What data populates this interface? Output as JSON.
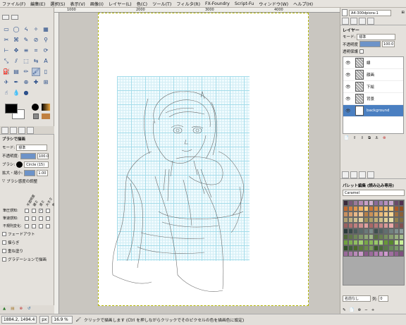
{
  "menu": [
    "ファイル(F)",
    "編集(E)",
    "選択(S)",
    "表示(V)",
    "画像(I)",
    "レイヤー(L)",
    "色(C)",
    "ツール(T)",
    "フィルタ(R)",
    "FX-Foundry",
    "Script-Fu",
    "ウィンドウ(W)",
    "ヘルプ(H)"
  ],
  "ruler_ticks": [
    "1000",
    "2000",
    "3000",
    "4000"
  ],
  "tools": [
    "rect-select",
    "ellipse-select",
    "free-select",
    "fuzzy-select",
    "select-by-color",
    "scissors",
    "foreground-select",
    "paths",
    "color-picker",
    "zoom",
    "measure",
    "move",
    "align",
    "crop",
    "rotate",
    "scale",
    "shear",
    "perspective",
    "flip",
    "text",
    "bucket-fill",
    "blend",
    "pencil",
    "paintbrush",
    "eraser",
    "airbrush",
    "ink",
    "clone",
    "heal",
    "perspective-clone",
    "smudge",
    "convolve",
    "dodge-burn"
  ],
  "tool_glyphs": [
    "▭",
    "◯",
    "ᔦ",
    "✧",
    "▦",
    "✂",
    "⌘",
    "✎",
    "⊘",
    "⚲",
    "⊢",
    "✥",
    "≡",
    "⌗",
    "⟳",
    "⤡",
    "⫽",
    "⬚",
    "⇆",
    "A",
    "⛽",
    "▤",
    "✏",
    "🖌",
    "▯",
    "✈",
    "✒",
    "⊕",
    "✚",
    "⊞",
    "☝",
    "💧",
    "●"
  ],
  "tool_active_index": 23,
  "tool_options": {
    "title": "ブラシで描画",
    "mode_label": "モード:",
    "mode_value": "標準",
    "opacity_label": "不透明度:",
    "opacity_value": "100.0",
    "brush_label": "ブラシ:",
    "brush_value": "Circle (15)",
    "scale_label": "拡大・縮小:",
    "scale_value": "1.00",
    "dynamics_title": "ブラシ感度の調整",
    "dyn_headers": [
      "不透明度",
      "硬さ",
      "速さ",
      "大きさ",
      "色"
    ],
    "dyn_rows": [
      "筆圧感知:",
      "筆速感知:",
      "不規則変化:"
    ],
    "fade_out": "フェードアウト",
    "jitter": "揺らぎ",
    "incremental": "重ね塗り",
    "gradient": "グラデーションで描画"
  },
  "right_panel": {
    "image_name": "A4-300dpiora-1",
    "layers_title": "レイヤー",
    "mode_label": "モード:",
    "mode_value": "標準",
    "opacity_label": "不透明度",
    "opacity_value": "100.0",
    "lock_label": "透明保護",
    "layers": [
      {
        "name": "線",
        "selected": false
      },
      {
        "name": "顔画",
        "selected": false
      },
      {
        "name": "下絵",
        "selected": false
      },
      {
        "name": "背景",
        "selected": false
      },
      {
        "name": "background",
        "selected": true
      }
    ],
    "palette_title": "パレット編集 (読み込み専用)",
    "palette_name": "Caramel",
    "color_name_placeholder": "名前なし",
    "columns_label": "列:",
    "columns_value": "0"
  },
  "palette_colors": [
    "#3a2a3a",
    "#7a5a7a",
    "#9a7a9a",
    "#b48ab4",
    "#c8a0c8",
    "#d0b0d0",
    "#8a6a9a",
    "#a080b0",
    "#b890c0",
    "#c8a8d0",
    "#6a4a6a",
    "#503050",
    "#c06a30",
    "#d08040",
    "#e09850",
    "#f0b060",
    "#f8c878",
    "#c87838",
    "#d89048",
    "#e8a858",
    "#f4bc70",
    "#fcd080",
    "#a85828",
    "#905020",
    "#c89060",
    "#d8a070",
    "#e8b888",
    "#f0c898",
    "#b88048",
    "#c89058",
    "#d8a868",
    "#e8b878",
    "#f0c888",
    "#f8d898",
    "#a07040",
    "#886038",
    "#b0a070",
    "#c0b080",
    "#d0c090",
    "#e0d0a0",
    "#a09058",
    "#b0a068",
    "#c0b078",
    "#d0c088",
    "#e0d098",
    "#e8e0a8",
    "#908050",
    "#807040",
    "#9a6060",
    "#b07070",
    "#c08080",
    "#d09090",
    "#e0a0a0",
    "#a86868",
    "#b87878",
    "#c88888",
    "#d89898",
    "#e8a8a8",
    "#906060",
    "#805050",
    "#2a3a3a",
    "#3a4a4a",
    "#4a5a5a",
    "#5a6a6a",
    "#6a7a7a",
    "#7a8a8a",
    "#405050",
    "#506060",
    "#607070",
    "#708080",
    "#809090",
    "#90a0a0",
    "#506838",
    "#607848",
    "#708858",
    "#809868",
    "#90a878",
    "#a0b888",
    "#587040",
    "#688050",
    "#789060",
    "#88a070",
    "#98b080",
    "#a8c090",
    "#70a040",
    "#80b050",
    "#90c060",
    "#a0d070",
    "#78a848",
    "#88b858",
    "#98c868",
    "#a8d878",
    "#689838",
    "#588830",
    "#b8e088",
    "#c8f098",
    "#305028",
    "#406038",
    "#4a6a2a",
    "#5a7a3a",
    "#6a8a4a",
    "#7a9a5a",
    "#3a5a2a",
    "#4a6a3a",
    "#5a7a4a",
    "#6a8a5a",
    "#7a9a6a",
    "#8aaa7a",
    "#9a6a9a",
    "#aa7aaa",
    "#ba8aba",
    "#ca9aca",
    "#8a5a8a",
    "#9a6a9a",
    "#b07ab0",
    "#c08ac0",
    "#d09ad0",
    "#a070a0",
    "#906090",
    "#805080"
  ],
  "status": {
    "coords": "1884.2, 1494.4",
    "unit": "px",
    "zoom": "16.9 %",
    "message": "クリックで描画します (Ctrl を押しながらクリックでそのピクセルの色を描画色に設定)"
  }
}
